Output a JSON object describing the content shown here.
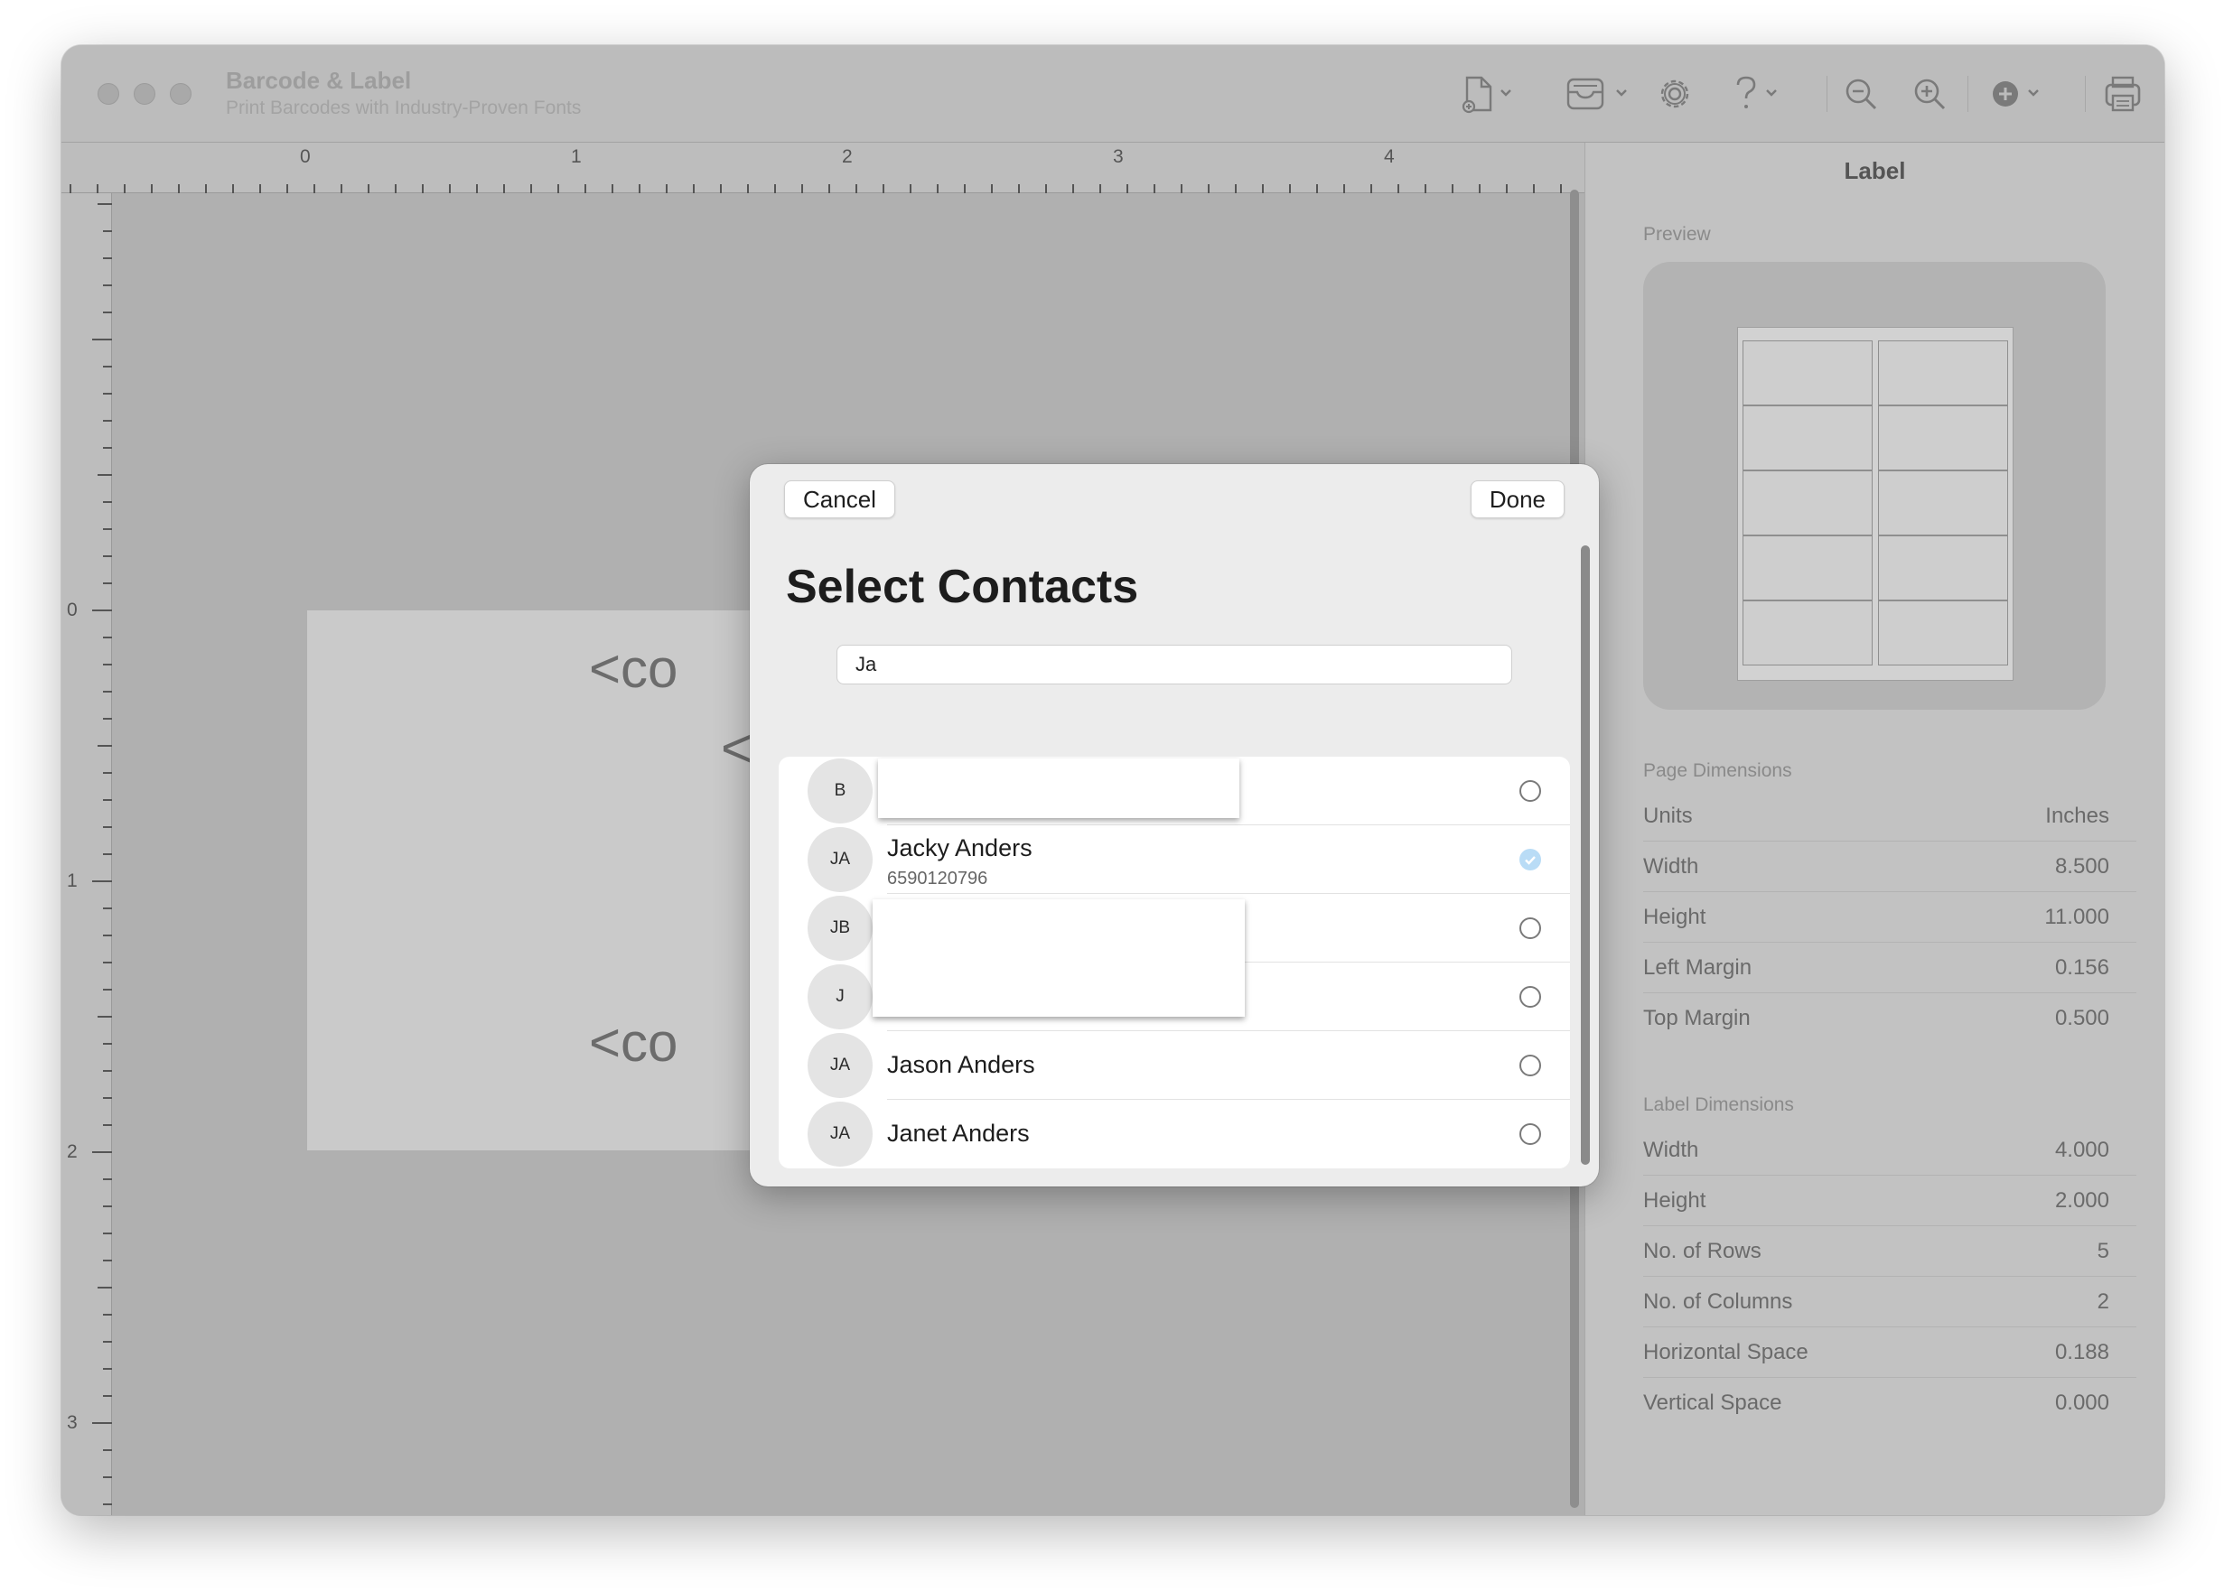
{
  "app": {
    "title": "Barcode & Label",
    "subtitle": "Print Barcodes with Industry-Proven Fonts"
  },
  "toolbar": {
    "icons": [
      "new-document-icon",
      "template-tray-icon",
      "gear-icon",
      "help-icon",
      "zoom-out-icon",
      "zoom-in-icon",
      "add-icon",
      "print-icon"
    ]
  },
  "rulers": {
    "horizontal": [
      "0",
      "1",
      "2",
      "3",
      "4"
    ],
    "vertical": [
      "0",
      "1",
      "2",
      "3"
    ]
  },
  "canvas": {
    "placeholder_1": "<co",
    "placeholder_2": "<",
    "placeholder_3": "<co"
  },
  "sidebar": {
    "title": "Label",
    "preview_label": "Preview",
    "preview_grid": {
      "rows": 5,
      "columns": 2
    },
    "page_dimensions": {
      "heading": "Page Dimensions",
      "rows": [
        {
          "label": "Units",
          "value": "Inches"
        },
        {
          "label": "Width",
          "value": "8.500"
        },
        {
          "label": "Height",
          "value": "11.000"
        },
        {
          "label": "Left Margin",
          "value": "0.156"
        },
        {
          "label": "Top Margin",
          "value": "0.500"
        }
      ]
    },
    "label_dimensions": {
      "heading": "Label Dimensions",
      "rows": [
        {
          "label": "Width",
          "value": "4.000"
        },
        {
          "label": "Height",
          "value": "2.000"
        },
        {
          "label": "No. of Rows",
          "value": "5"
        },
        {
          "label": "No. of Columns",
          "value": "2"
        },
        {
          "label": "Horizontal Space",
          "value": "0.188"
        },
        {
          "label": "Vertical Space",
          "value": "0.000"
        }
      ]
    }
  },
  "dialog": {
    "cancel_label": "Cancel",
    "done_label": "Done",
    "title": "Select Contacts",
    "search_value": "Ja",
    "contacts": [
      {
        "initials": "B",
        "name": "",
        "phone": "",
        "selected": false
      },
      {
        "initials": "JA",
        "name": "Jacky Anders",
        "phone": "6590120796",
        "selected": true
      },
      {
        "initials": "JB",
        "name": "",
        "phone": "",
        "selected": false
      },
      {
        "initials": "J",
        "name": "",
        "phone": "",
        "selected": false
      },
      {
        "initials": "JA",
        "name": "Jason Anders",
        "phone": "",
        "selected": false
      },
      {
        "initials": "JA",
        "name": "Janet Anders",
        "phone": "",
        "selected": false
      }
    ]
  },
  "colors": {
    "selected_check": "#b9dcf6"
  }
}
